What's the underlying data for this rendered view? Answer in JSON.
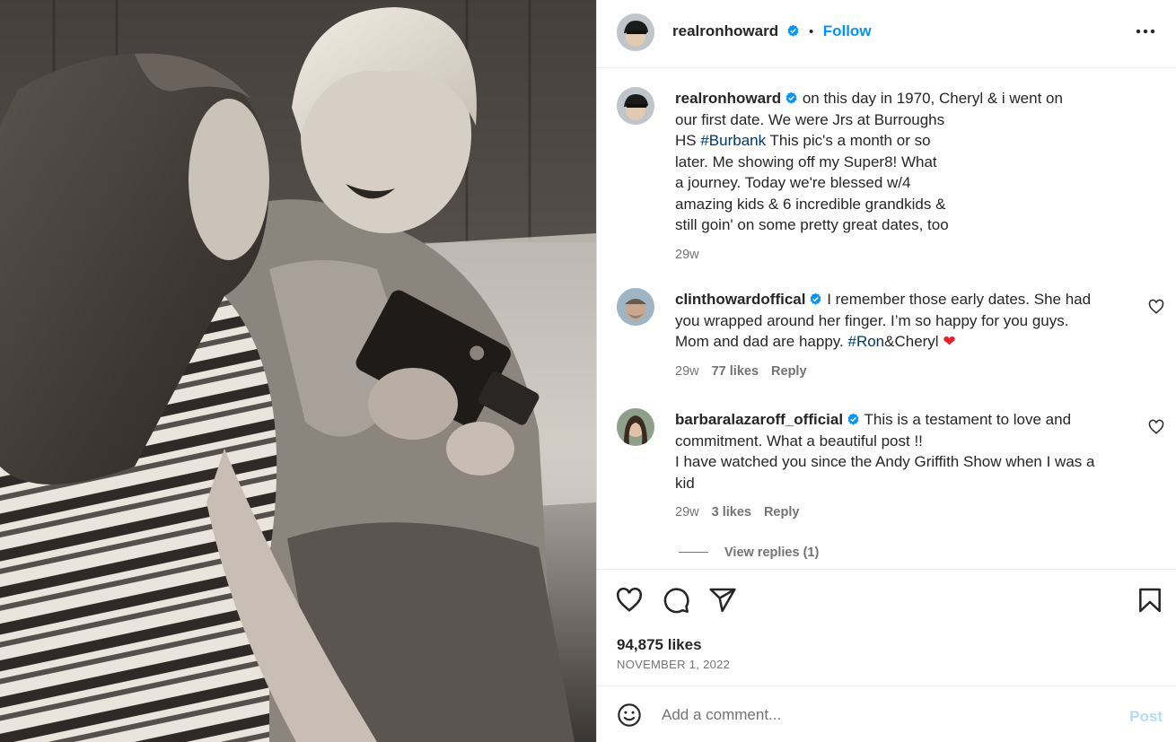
{
  "post": {
    "author": "realronhoward",
    "follow_label": "Follow",
    "separator": "•"
  },
  "caption": {
    "username": "realronhoward",
    "lines": [
      "on this day in 1970, Cheryl & i went on",
      "our first date. We were Jrs at Burroughs",
      "HS ",
      "This pic's a month or so",
      "later. Me showing off my Super8! What",
      "a journey. Today we're blessed w/4",
      "amazing kids & 6 incredible grandkids &",
      "still goin' on some pretty great dates, too"
    ],
    "hashtag": "#Burbank",
    "time": "29w"
  },
  "comments": [
    {
      "username": "clinthowardoffical",
      "line1": "I remember those early dates. She had",
      "line2": "you wrapped around her finger. I’m so happy for you guys.",
      "line3a": "Mom and dad are happy. ",
      "hashtag": "#Ron",
      "line3b": "&Cheryl ",
      "emoji": "❤",
      "time": "29w",
      "likes": "77 likes",
      "reply": "Reply"
    },
    {
      "username": "barbaralazaroff_official",
      "line1": "This is a testament to love and",
      "line2": "commitment. What a beautiful post !!",
      "line3": "I have watched you since the Andy Griffith Show when I was a",
      "line4": "kid",
      "time": "29w",
      "likes": "3 likes",
      "reply": "Reply",
      "view_replies": "View replies (1)"
    }
  ],
  "actions": {
    "likes": "94,875 likes",
    "date": "NOVEMBER 1, 2022"
  },
  "add_comment": {
    "placeholder": "Add a comment...",
    "post_label": "Post"
  },
  "icons": {
    "verified": "verified-badge-icon",
    "more": "more-options-icon",
    "like": "heart-icon",
    "comment": "comment-icon",
    "share": "share-icon",
    "save": "bookmark-icon",
    "emoji": "emoji-icon"
  },
  "colors": {
    "link": "#0095f6",
    "hashtag": "#00376b",
    "muted": "#737373",
    "post_disabled": "#b3dbff",
    "heart_red": "#ed1c24"
  }
}
